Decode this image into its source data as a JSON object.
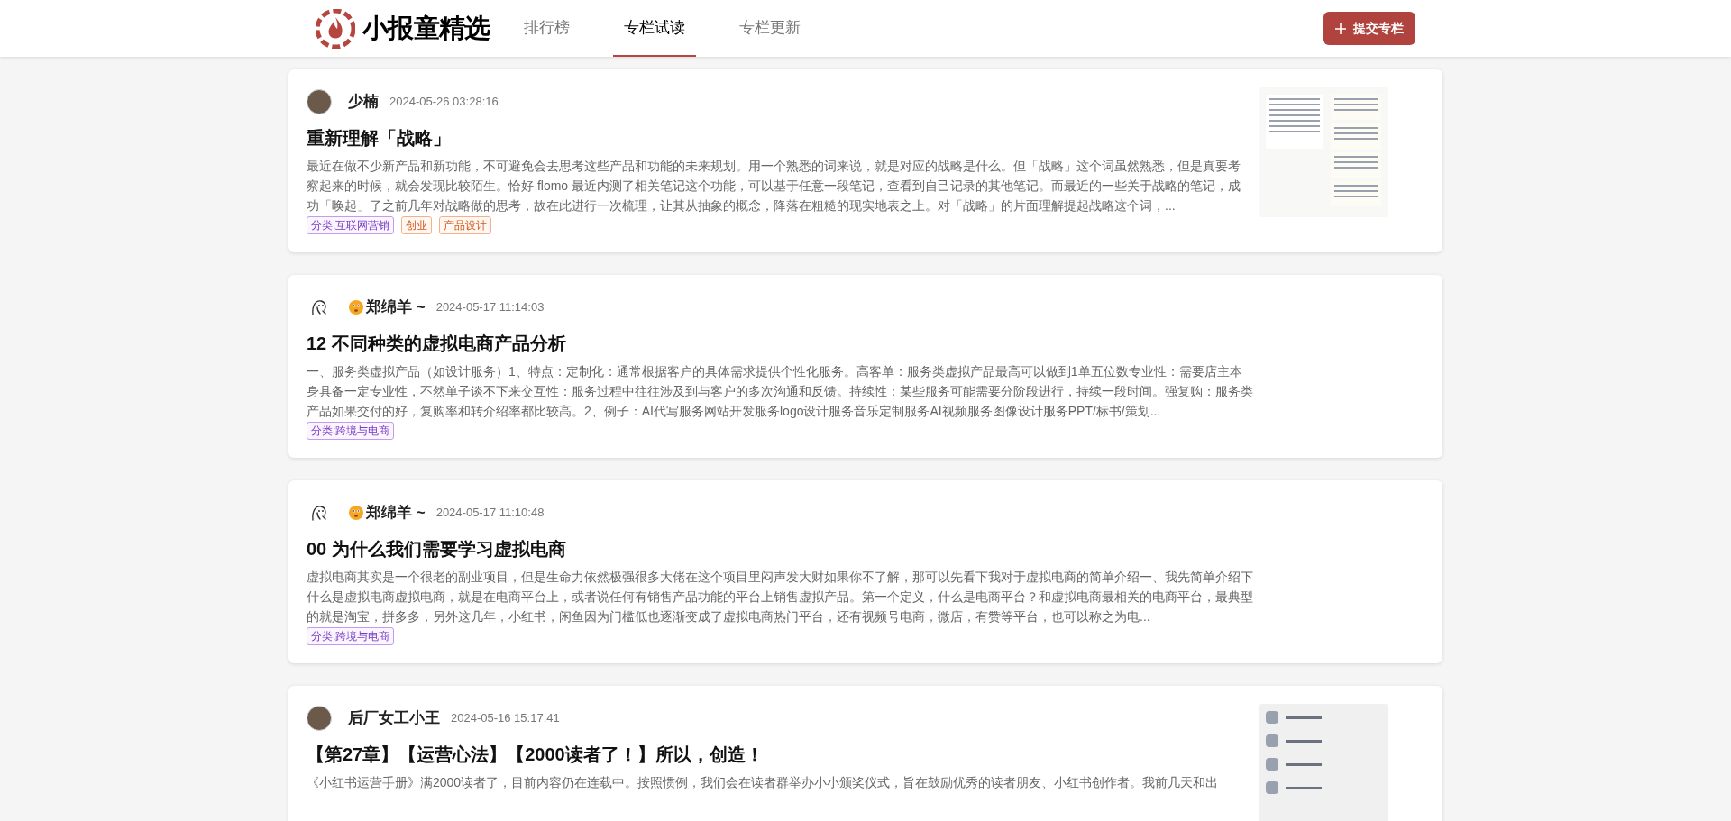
{
  "header": {
    "brand": "小报童精选",
    "tabs": [
      {
        "label": "排行榜",
        "selected": false
      },
      {
        "label": "专栏试读",
        "selected": true
      },
      {
        "label": "专栏更新",
        "selected": false
      }
    ],
    "submit_button": "提交专栏"
  },
  "posts": [
    {
      "author": "少楠",
      "avatar": {
        "kind": "photo"
      },
      "emoji": false,
      "time": "2024-05-26 03:28:16",
      "title": "重新理解「战略」",
      "excerpt": "最近在做不少新产品和新功能，不可避免会去思考这些产品和功能的未来规划。用一个熟悉的词来说，就是对应的战略是什么。但「战略」这个词虽然熟悉，但是真要考察起来的时候，就会发现比较陌生。恰好 flomo 最近内测了相关笔记这个功能，可以基于任意一段笔记，查看到自己记录的其他笔记。而最近的一些关于战略的笔记，成功「唤起」了之前几年对战略做的思考，故在此进行一次梳理，让其从抽象的概念，降落在粗糙的现实地表之上。对「战略」的片面理解提起战略这个词，...",
      "tags": [
        {
          "label": "分类:互联网营销",
          "kind": "category"
        },
        {
          "label": "创业",
          "kind": "topic"
        },
        {
          "label": "产品设计",
          "kind": "topic"
        }
      ],
      "thumbnail": {
        "kind": "document"
      }
    },
    {
      "author": "郑绵羊 ~",
      "avatar": {
        "kind": "sketch"
      },
      "emoji": true,
      "time": "2024-05-17 11:14:03",
      "title": "12 不同种类的虚拟电商产品分析",
      "excerpt": "一、服务类虚拟产品（如设计服务）1、特点：定制化：通常根据客户的具体需求提供个性化服务。高客单：服务类虚拟产品最高可以做到1单五位数专业性：需要店主本身具备一定专业性，不然单子谈不下来交互性：服务过程中往往涉及到与客户的多次沟通和反馈。持续性：某些服务可能需要分阶段进行，持续一段时间。强复购：服务类产品如果交付的好，复购率和转介绍率都比较高。2、例子：AI代写服务网站开发服务logo设计服务音乐定制服务AI视频服务图像设计服务PPT/标书/策划...",
      "tags": [
        {
          "label": "分类:跨境与电商",
          "kind": "category"
        }
      ]
    },
    {
      "author": "郑绵羊 ~",
      "avatar": {
        "kind": "sketch"
      },
      "emoji": true,
      "time": "2024-05-17 11:10:48",
      "title": "00 为什么我们需要学习虚拟电商",
      "excerpt": "虚拟电商其实是一个很老的副业项目，但是生命力依然极强很多大佬在这个项目里闷声发大财如果你不了解，那可以先看下我对于虚拟电商的简单介绍一、我先简单介绍下什么是虚拟电商虚拟电商，就是在电商平台上，或者说任何有销售产品功能的平台上销售虚拟产品。第一个定义，什么是电商平台？和虚拟电商最相关的电商平台，最典型的就是淘宝，拼多多，另外这几年，小红书，闲鱼因为门槛低也逐渐变成了虚拟电商热门平台，还有视频号电商，微店，有赞等平台，也可以称之为电...",
      "tags": [
        {
          "label": "分类:跨境与电商",
          "kind": "category"
        }
      ]
    },
    {
      "author": "后厂女工小王",
      "avatar": {
        "kind": "photo"
      },
      "emoji": false,
      "time": "2024-05-16 15:17:41",
      "title": "【第27章】【运营心法】【2000读者了！】所以，创造！",
      "excerpt": "《小红书运营手册》满2000读者了，目前内容仍在连载中。按照惯例，我们会在读者群举办小小颁奖仪式，旨在鼓励优秀的读者朋友、小红书创作者。我前几天和出",
      "thumbnail": {
        "kind": "list"
      }
    }
  ]
}
